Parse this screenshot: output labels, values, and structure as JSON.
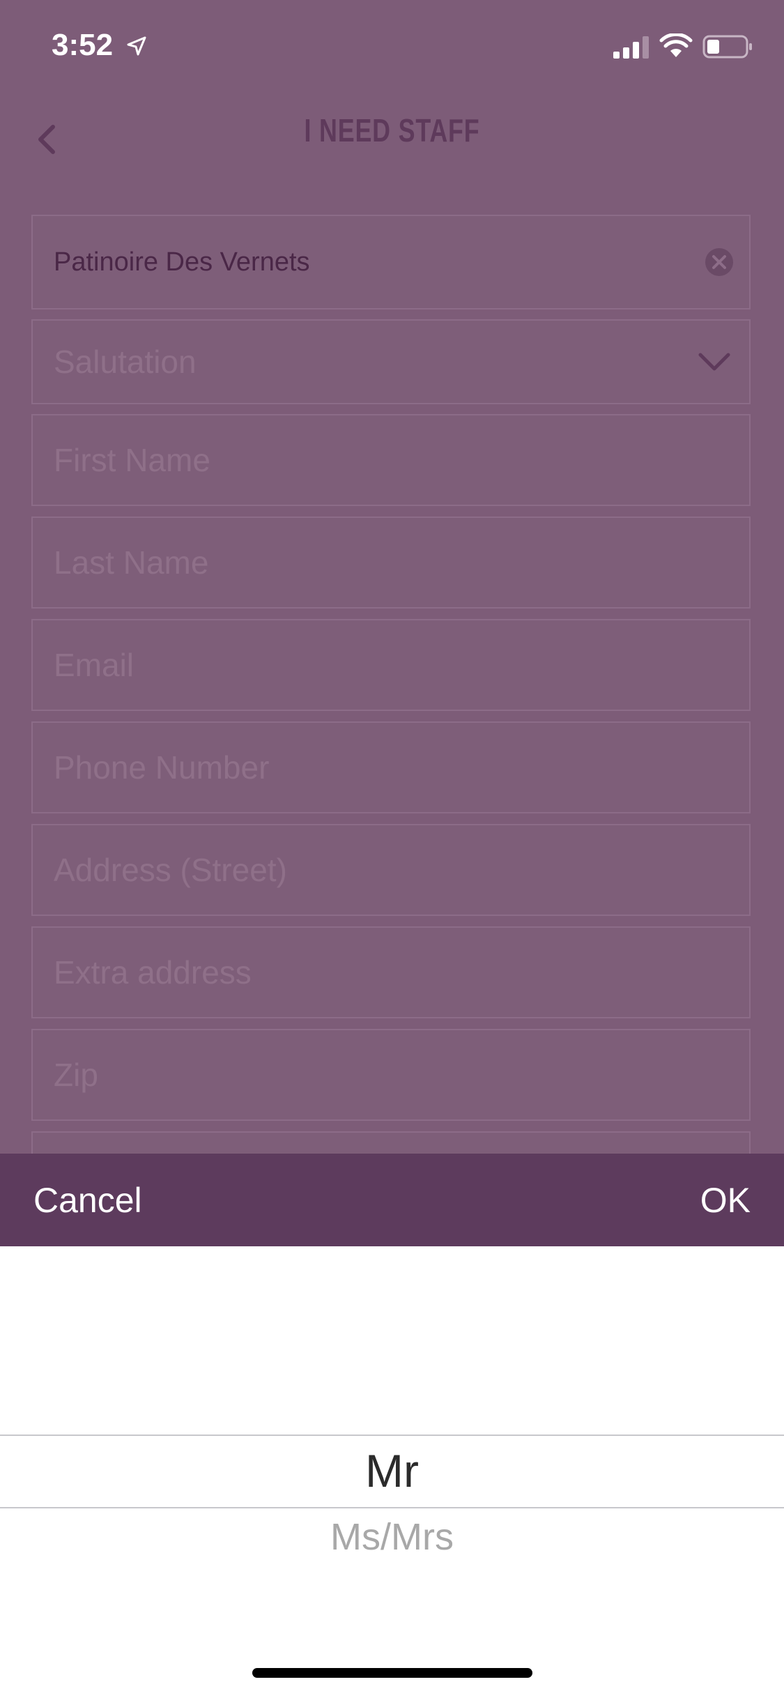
{
  "status_bar": {
    "time": "3:52"
  },
  "header": {
    "title": "I NEED STAFF"
  },
  "form": {
    "venue_value": "Patinoire Des Vernets",
    "salutation_placeholder": "Salutation",
    "first_name_placeholder": "First Name",
    "last_name_placeholder": "Last Name",
    "email_placeholder": "Email",
    "phone_placeholder": "Phone Number",
    "address_placeholder": "Address (Street)",
    "extra_address_placeholder": "Extra address",
    "zip_placeholder": "Zip"
  },
  "picker": {
    "cancel_label": "Cancel",
    "ok_label": "OK",
    "selected": "Mr",
    "next": "Ms/Mrs"
  },
  "colors": {
    "overlay": "#7d5c78",
    "title": "#5e3a5b",
    "toolbar": "#5d3b5d"
  },
  "icons": [
    "location-arrow-icon",
    "signal-icon",
    "wifi-icon",
    "battery-icon",
    "back-chevron-icon",
    "clear-icon",
    "chevron-down-icon"
  ]
}
